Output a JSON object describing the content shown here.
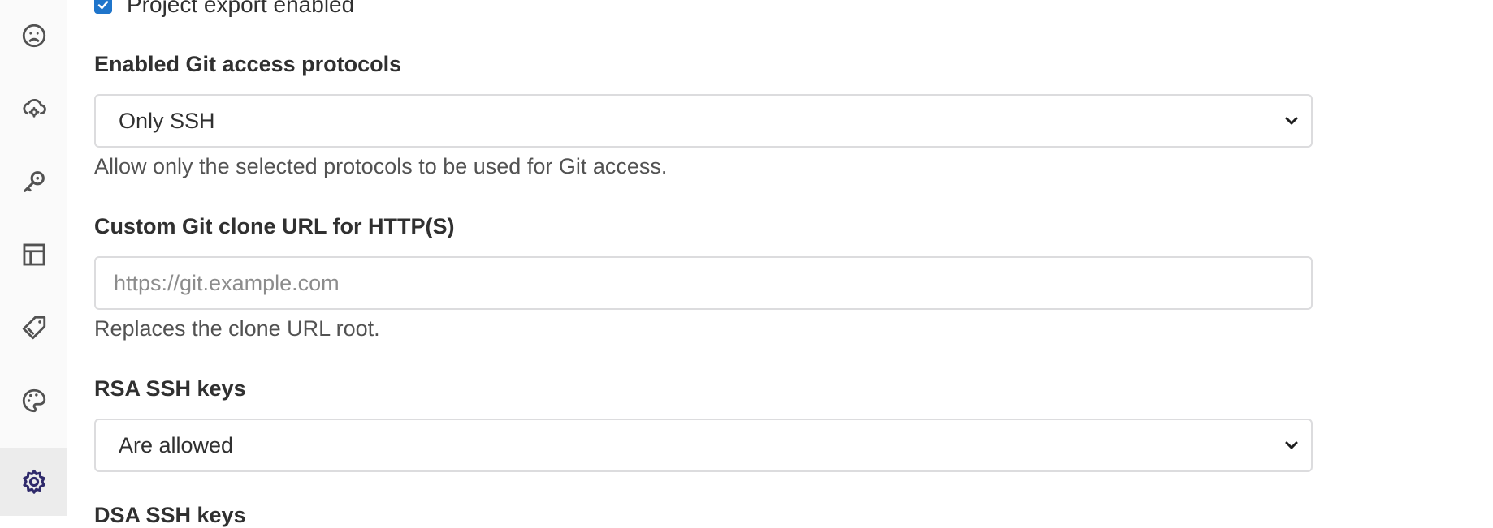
{
  "sidebar": {
    "items": [
      {
        "icon": "frown-face-icon"
      },
      {
        "icon": "cloud-gear-icon"
      },
      {
        "icon": "key-icon"
      },
      {
        "icon": "layout-icon"
      },
      {
        "icon": "label-tag-icon"
      },
      {
        "icon": "palette-icon"
      },
      {
        "icon": "settings-gear-icon",
        "active": true
      }
    ]
  },
  "form": {
    "project_export": {
      "label": "Project export enabled",
      "checked": true
    },
    "git_protocols": {
      "label": "Enabled Git access protocols",
      "value": "Only SSH",
      "help": "Allow only the selected protocols to be used for Git access."
    },
    "clone_url": {
      "label": "Custom Git clone URL for HTTP(S)",
      "placeholder": "https://git.example.com",
      "help": "Replaces the clone URL root."
    },
    "rsa_keys": {
      "label": "RSA SSH keys",
      "value": "Are allowed"
    },
    "dsa_keys": {
      "label": "DSA SSH keys"
    }
  },
  "colors": {
    "accent": "#1f75cb",
    "active_icon": "#2f2a6b",
    "icon": "#525252"
  }
}
